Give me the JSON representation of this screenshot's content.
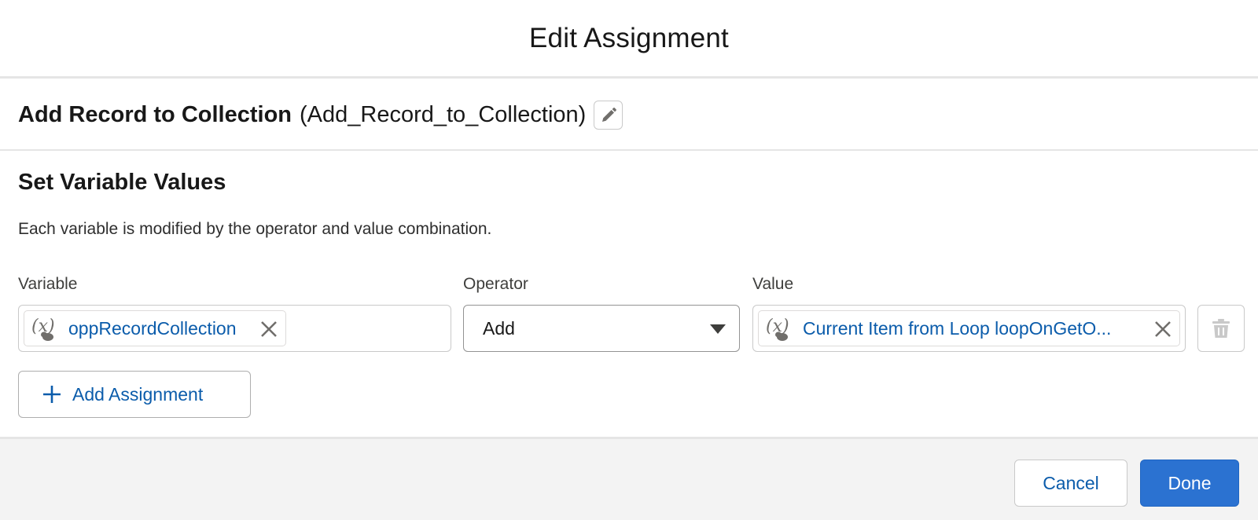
{
  "modal": {
    "title": "Edit Assignment"
  },
  "element": {
    "label": "Add Record to Collection",
    "api_name": "(Add_Record_to_Collection)",
    "edit_icon": "pencil-icon"
  },
  "section": {
    "title": "Set Variable Values",
    "description": "Each variable is modified by the operator and value combination."
  },
  "columns": {
    "variable": "Variable",
    "operator": "Operator",
    "value": "Value"
  },
  "assignment": {
    "variable": {
      "text": "oppRecordCollection",
      "icon": "variable-icon"
    },
    "operator": {
      "selected": "Add"
    },
    "value": {
      "text": "Current Item from Loop loopOnGetO...",
      "icon": "variable-icon"
    }
  },
  "add_assignment_label": "Add Assignment",
  "footer": {
    "cancel": "Cancel",
    "done": "Done"
  },
  "colors": {
    "link": "#0b5cab",
    "brand": "#2b72d1",
    "footer_bg": "#f3f3f3"
  }
}
